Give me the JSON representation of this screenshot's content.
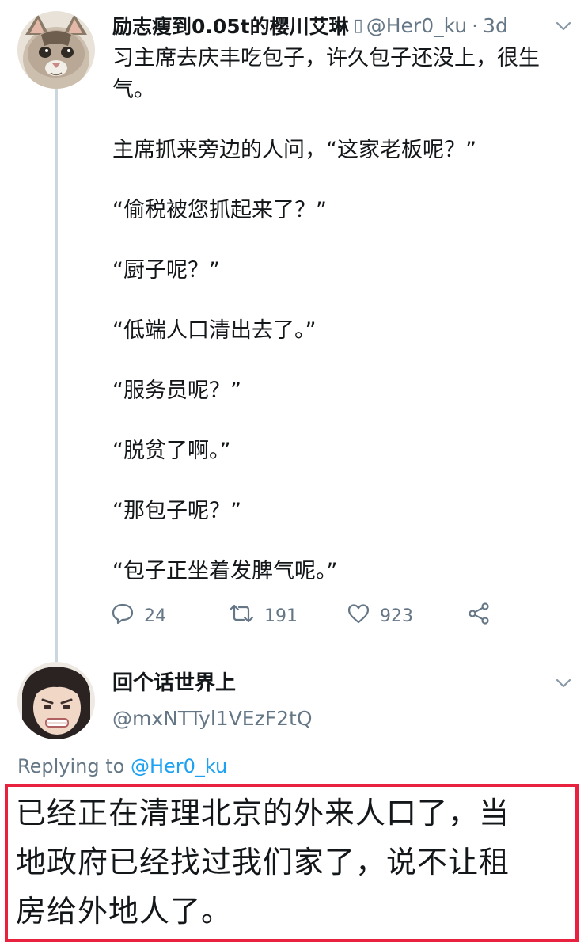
{
  "colors": {
    "text_primary": "#14171a",
    "text_secondary": "#657786",
    "link": "#1da1f2",
    "thread_line": "#ccd6dd",
    "highlight_border": "#e8213f"
  },
  "tweet": {
    "author": {
      "display_name": "励志瘦到0.05t的樱川艾琳",
      "badge_glyph": "▯",
      "handle": "@Her0_ku",
      "separator": "·",
      "time": "3d",
      "avatar_icon": "cat-avatar-icon"
    },
    "paragraphs": [
      "习主席去庆丰吃包子，许久包子还没上，很生气。",
      "主席抓来旁边的人问，“这家老板呢？”",
      "“偷税被您抓起来了？”",
      "“厨子呢？”",
      "“低端人口清出去了。”",
      "“服务员呢？”",
      "“脱贫了啊。”",
      "“那包子呢？”",
      "“包子正坐着发脾气呢。”"
    ],
    "actions": {
      "replies": "24",
      "retweets": "191",
      "likes": "923",
      "reply_icon": "comment-icon",
      "retweet_icon": "retweet-icon",
      "like_icon": "heart-icon",
      "share_icon": "share-icon"
    }
  },
  "reply": {
    "author": {
      "display_name": "回个话世界上",
      "handle": "@mxNTTyl1VEzF2tQ",
      "avatar_icon": "user-avatar-icon"
    },
    "replying_to_prefix": "Replying to ",
    "replying_to_handle": "@Her0_ku",
    "text_lines": [
      "已经正在清理北京的外来人口了，当",
      "地政府已经找过我们家了，说不让租",
      "房给外地人了。"
    ]
  }
}
